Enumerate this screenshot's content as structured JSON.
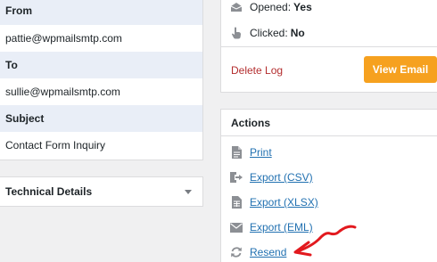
{
  "details": {
    "from_label": "From",
    "from_value": "pattie@wpmailsmtp.com",
    "to_label": "To",
    "to_value": "sullie@wpmailsmtp.com",
    "subject_label": "Subject",
    "subject_value": "Contact Form Inquiry"
  },
  "technical": {
    "title": "Technical Details",
    "icon": "chevron-down-icon"
  },
  "status": {
    "opened_label": "Opened:",
    "opened_value": "Yes",
    "clicked_label": "Clicked:",
    "clicked_value": "No",
    "delete_label": "Delete Log",
    "view_label": "View Email"
  },
  "actions": {
    "title": "Actions",
    "items": [
      {
        "label": "Print",
        "icon": "print-icon"
      },
      {
        "label": "Export (CSV)",
        "icon": "export-icon"
      },
      {
        "label": "Export (XLSX)",
        "icon": "spreadsheet-icon"
      },
      {
        "label": "Export (EML)",
        "icon": "envelope-icon"
      },
      {
        "label": "Resend",
        "icon": "resend-icon"
      }
    ]
  },
  "colors": {
    "accent": "#f6a11f",
    "link": "#2271b1",
    "danger": "#b32d2e",
    "annotation": "#e2191e",
    "label_bg": "#e9eef7"
  }
}
